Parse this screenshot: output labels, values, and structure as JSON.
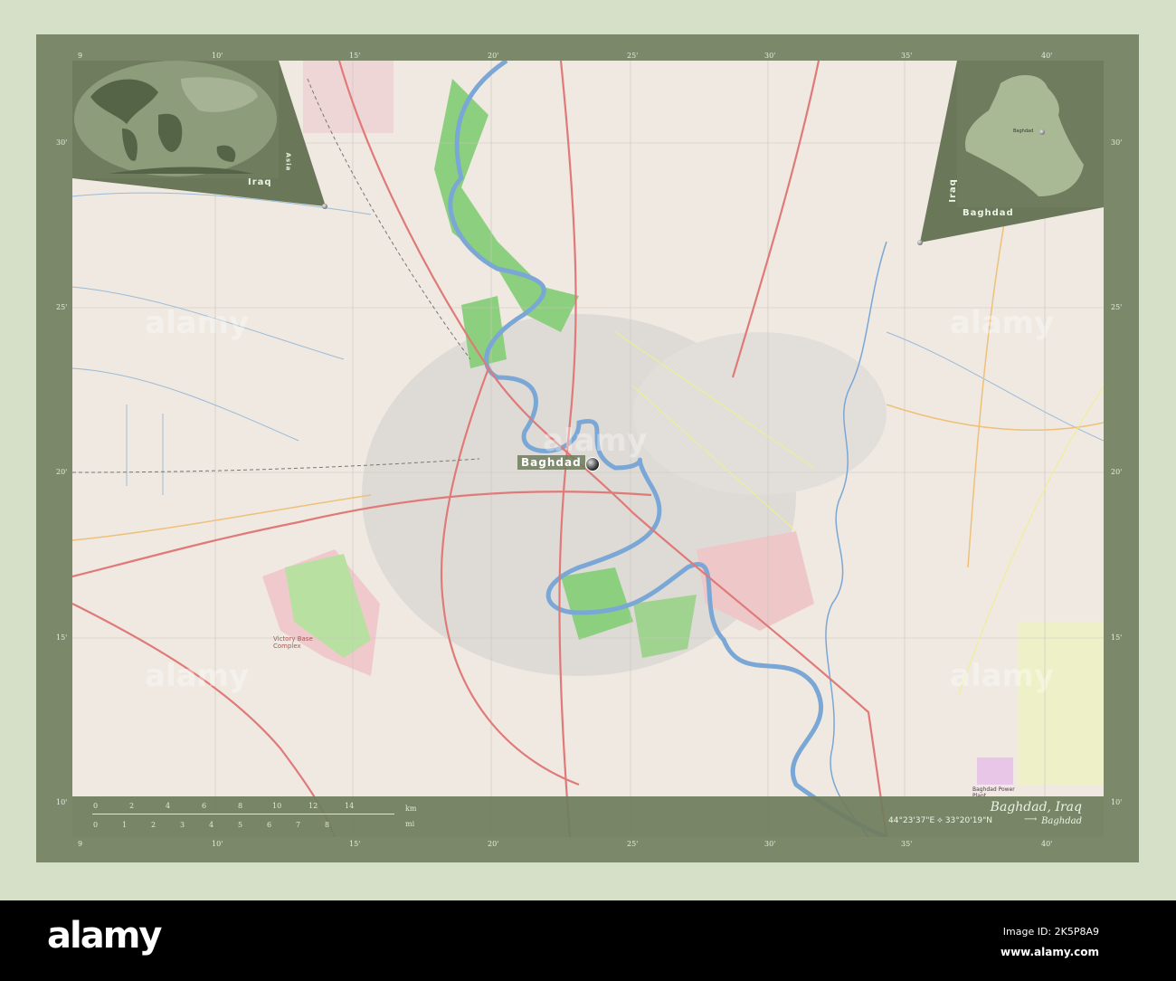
{
  "map": {
    "title": "Baghdad, Iraq",
    "subtitle": "Baghdad",
    "coordinates": "44°23'37\"E ⟡ 33°20'19\"N",
    "arrow": "⟶",
    "city_label": "Baghdad",
    "inset_world": {
      "label_region": "Asia",
      "label_country": "Iraq"
    },
    "inset_country": {
      "label_country": "Iraq",
      "label_province": "Baghdad",
      "label_city": "Baghdad"
    },
    "ticks_top": [
      "9",
      "10'",
      "15'",
      "20'",
      "25'",
      "30'",
      "35'",
      "40'"
    ],
    "ticks_bottom": [
      "9",
      "10'",
      "15'",
      "20'",
      "25'",
      "30'",
      "35'",
      "40'"
    ],
    "ticks_left": [
      "30'",
      "25'",
      "20'",
      "15'",
      "10'"
    ],
    "ticks_right": [
      "30'",
      "25'",
      "20'",
      "15'",
      "10'"
    ],
    "scale": {
      "km_unit": "km",
      "mi_unit": "mi",
      "km_labels": [
        "0",
        "2",
        "4",
        "6",
        "8",
        "10",
        "12",
        "14"
      ],
      "mi_labels": [
        "0",
        "1",
        "2",
        "3",
        "4",
        "5",
        "6",
        "7",
        "8"
      ]
    },
    "place_labels": {
      "airport": "Victory Base Complex",
      "power": "Baghdad Power Plant"
    }
  },
  "footer": {
    "logo": "alamy",
    "image_id": "Image ID: 2K5P8A9",
    "url": "www.alamy.com"
  },
  "colors": {
    "frame": "#7b8869",
    "background": "#d6e0c8",
    "river": "#7aa7d6",
    "park": "#8ccf7e",
    "motorway": "#e07a78"
  }
}
